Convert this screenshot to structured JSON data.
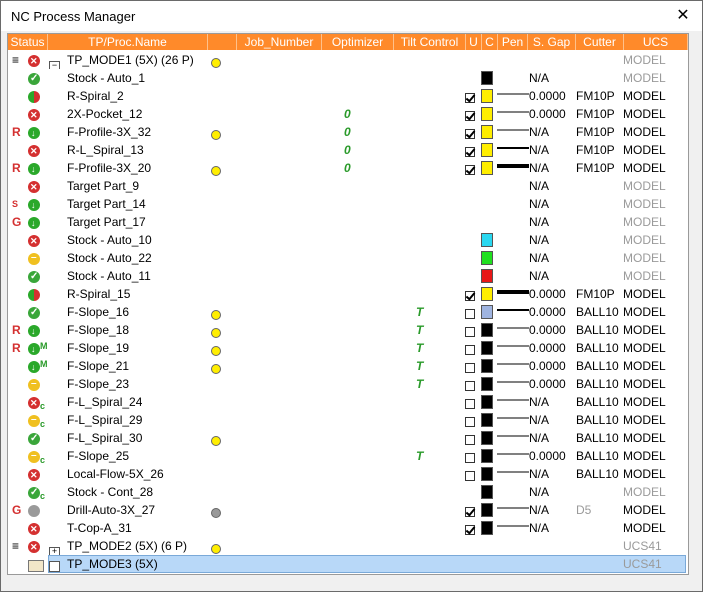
{
  "window": {
    "title": "NC Process Manager",
    "close_label": "✕"
  },
  "columns": [
    "Status",
    "TP/Proc.Name",
    "Job_Number",
    "Optimizer",
    "Tilt Control",
    "U",
    "C",
    "Pen",
    "S. Gap",
    "Cutter",
    "UCS"
  ],
  "rows": [
    {
      "prefix": "≡",
      "icon": "x",
      "suffix": "",
      "tree": "⊟",
      "name": "TP_MODE1 (5X) (26 P)",
      "bulb": "yellow",
      "opt": "",
      "tilt": "",
      "u": "",
      "color": "",
      "pen": 0,
      "gap": "",
      "cutter": "",
      "ucs": "MODEL",
      "ucs_gray": true
    },
    {
      "prefix": "",
      "icon": "check",
      "suffix": "",
      "tree": "",
      "name": "Stock - Auto_1",
      "bulb": "",
      "opt": "",
      "tilt": "",
      "u": "",
      "color": "#000000",
      "pen": 0,
      "gap": "N/A",
      "cutter": "",
      "ucs": "MODEL",
      "ucs_gray": true
    },
    {
      "prefix": "",
      "icon": "redgreen",
      "suffix": "",
      "tree": "",
      "name": "R-Spiral_2",
      "bulb": "",
      "opt": "",
      "tilt": "",
      "u": "on",
      "color": "#ffee00",
      "pen": 1,
      "gap": "0.0000",
      "cutter": "FM10P",
      "ucs": "MODEL",
      "ucs_gray": false
    },
    {
      "prefix": "",
      "icon": "x",
      "suffix": "",
      "tree": "",
      "name": "2X-Pocket_12",
      "bulb": "",
      "opt": "0",
      "tilt": "",
      "u": "on",
      "color": "#ffee00",
      "pen": 1,
      "gap": "0.0000",
      "cutter": "FM10P",
      "ucs": "MODEL",
      "ucs_gray": false
    },
    {
      "prefix": "R",
      "icon": "green",
      "suffix": "",
      "tree": "",
      "name": "F-Profile-3X_32",
      "bulb": "yellow",
      "opt": "0",
      "tilt": "",
      "u": "on",
      "color": "#ffee00",
      "pen": 1,
      "gap": "N/A",
      "cutter": "FM10P",
      "ucs": "MODEL",
      "ucs_gray": false
    },
    {
      "prefix": "",
      "icon": "x",
      "suffix": "",
      "tree": "",
      "name": "R-L_Spiral_13",
      "bulb": "",
      "opt": "0",
      "tilt": "",
      "u": "on",
      "color": "#ffee00",
      "pen": 2,
      "gap": "N/A",
      "cutter": "FM10P",
      "ucs": "MODEL",
      "ucs_gray": false
    },
    {
      "prefix": "R",
      "icon": "green",
      "suffix": "",
      "tree": "",
      "name": "F-Profile-3X_20",
      "bulb": "yellow",
      "opt": "0",
      "tilt": "",
      "u": "on",
      "color": "#ffee00",
      "pen": 4,
      "gap": "N/A",
      "cutter": "FM10P",
      "ucs": "MODEL",
      "ucs_gray": false
    },
    {
      "prefix": "",
      "icon": "x",
      "suffix": "",
      "tree": "",
      "name": "Target Part_9",
      "bulb": "",
      "opt": "",
      "tilt": "",
      "u": "",
      "color": "",
      "pen": 0,
      "gap": "N/A",
      "cutter": "",
      "ucs": "MODEL",
      "ucs_gray": true
    },
    {
      "prefix": "S",
      "icon": "green",
      "suffix": "",
      "tree": "",
      "name": "Target Part_14",
      "bulb": "",
      "opt": "",
      "tilt": "",
      "u": "",
      "color": "",
      "pen": 0,
      "gap": "N/A",
      "cutter": "",
      "ucs": "MODEL",
      "ucs_gray": true
    },
    {
      "prefix": "G",
      "icon": "green",
      "suffix": "",
      "tree": "",
      "name": "Target Part_17",
      "bulb": "",
      "opt": "",
      "tilt": "",
      "u": "",
      "color": "",
      "pen": 0,
      "gap": "N/A",
      "cutter": "",
      "ucs": "MODEL",
      "ucs_gray": true
    },
    {
      "prefix": "",
      "icon": "x",
      "suffix": "",
      "tree": "",
      "name": "Stock - Auto_10",
      "bulb": "",
      "opt": "",
      "tilt": "",
      "u": "",
      "color": "#2ad8f0",
      "pen": 0,
      "gap": "N/A",
      "cutter": "",
      "ucs": "MODEL",
      "ucs_gray": true
    },
    {
      "prefix": "",
      "icon": "yellow",
      "suffix": "",
      "tree": "",
      "name": "Stock - Auto_22",
      "bulb": "",
      "opt": "",
      "tilt": "",
      "u": "",
      "color": "#20e020",
      "pen": 0,
      "gap": "N/A",
      "cutter": "",
      "ucs": "MODEL",
      "ucs_gray": true
    },
    {
      "prefix": "",
      "icon": "check",
      "suffix": "",
      "tree": "",
      "name": "Stock - Auto_11",
      "bulb": "",
      "opt": "",
      "tilt": "",
      "u": "",
      "color": "#e81818",
      "pen": 0,
      "gap": "N/A",
      "cutter": "",
      "ucs": "MODEL",
      "ucs_gray": true
    },
    {
      "prefix": "",
      "icon": "redgreen",
      "suffix": "",
      "tree": "",
      "name": "R-Spiral_15",
      "bulb": "",
      "opt": "",
      "tilt": "",
      "u": "on",
      "color": "#ffee00",
      "pen": 4,
      "gap": "0.0000",
      "cutter": "FM10P",
      "ucs": "MODEL",
      "ucs_gray": false
    },
    {
      "prefix": "",
      "icon": "check",
      "suffix": "",
      "tree": "",
      "name": "F-Slope_16",
      "bulb": "yellow",
      "opt": "",
      "tilt": "T",
      "u": "off",
      "color": "#9fb4e0",
      "pen": 2,
      "gap": "0.0000",
      "cutter": "BALL10",
      "ucs": "MODEL",
      "ucs_gray": false
    },
    {
      "prefix": "R",
      "icon": "green",
      "suffix": "",
      "tree": "",
      "name": "F-Slope_18",
      "bulb": "yellow",
      "opt": "",
      "tilt": "T",
      "u": "off",
      "color": "#000000",
      "pen": 1,
      "gap": "0.0000",
      "cutter": "BALL10",
      "ucs": "MODEL",
      "ucs_gray": false
    },
    {
      "prefix": "R",
      "icon": "green",
      "suffix": "M",
      "tree": "",
      "name": "F-Slope_19",
      "bulb": "yellow",
      "opt": "",
      "tilt": "T",
      "u": "off",
      "color": "#000000",
      "pen": 1,
      "gap": "0.0000",
      "cutter": "BALL10",
      "ucs": "MODEL",
      "ucs_gray": false
    },
    {
      "prefix": "",
      "icon": "green",
      "suffix": "M",
      "tree": "",
      "name": "F-Slope_21",
      "bulb": "yellow",
      "opt": "",
      "tilt": "T",
      "u": "off",
      "color": "#000000",
      "pen": 1,
      "gap": "0.0000",
      "cutter": "BALL10",
      "ucs": "MODEL",
      "ucs_gray": false
    },
    {
      "prefix": "",
      "icon": "yellow",
      "suffix": "",
      "tree": "",
      "name": "F-Slope_23",
      "bulb": "",
      "opt": "",
      "tilt": "T",
      "u": "off",
      "color": "#000000",
      "pen": 1,
      "gap": "0.0000",
      "cutter": "BALL10",
      "ucs": "MODEL",
      "ucs_gray": false
    },
    {
      "prefix": "",
      "icon": "x",
      "suffix": "c",
      "tree": "",
      "name": "F-L_Spiral_24",
      "bulb": "",
      "opt": "",
      "tilt": "",
      "u": "off",
      "color": "#000000",
      "pen": 1,
      "gap": "N/A",
      "cutter": "BALL10",
      "ucs": "MODEL",
      "ucs_gray": false
    },
    {
      "prefix": "",
      "icon": "yellow",
      "suffix": "c",
      "tree": "",
      "name": "F-L_Spiral_29",
      "bulb": "",
      "opt": "",
      "tilt": "",
      "u": "off",
      "color": "#000000",
      "pen": 1,
      "gap": "N/A",
      "cutter": "BALL10",
      "ucs": "MODEL",
      "ucs_gray": false
    },
    {
      "prefix": "",
      "icon": "check",
      "suffix": "",
      "tree": "",
      "name": "F-L_Spiral_30",
      "bulb": "yellow",
      "opt": "",
      "tilt": "",
      "u": "off",
      "color": "#000000",
      "pen": 1,
      "gap": "N/A",
      "cutter": "BALL10",
      "ucs": "MODEL",
      "ucs_gray": false
    },
    {
      "prefix": "",
      "icon": "yellow",
      "suffix": "c",
      "tree": "",
      "name": "F-Slope_25",
      "bulb": "",
      "opt": "",
      "tilt": "T",
      "u": "off",
      "color": "#000000",
      "pen": 1,
      "gap": "0.0000",
      "cutter": "BALL10",
      "ucs": "MODEL",
      "ucs_gray": false
    },
    {
      "prefix": "",
      "icon": "x",
      "suffix": "",
      "tree": "",
      "name": "Local-Flow-5X_26",
      "bulb": "",
      "opt": "",
      "tilt": "",
      "u": "off",
      "color": "#000000",
      "pen": 1,
      "gap": "N/A",
      "cutter": "BALL10",
      "ucs": "MODEL",
      "ucs_gray": false
    },
    {
      "prefix": "",
      "icon": "check",
      "suffix": "c",
      "tree": "",
      "name": "Stock - Cont_28",
      "bulb": "",
      "opt": "",
      "tilt": "",
      "u": "",
      "color": "#000000",
      "pen": 0,
      "gap": "N/A",
      "cutter": "",
      "ucs": "MODEL",
      "ucs_gray": true
    },
    {
      "prefix": "G",
      "icon": "gray",
      "suffix": "",
      "tree": "",
      "name": "Drill-Auto-3X_27",
      "bulb": "gray",
      "opt": "",
      "tilt": "",
      "u": "on",
      "color": "#000000",
      "pen": 1,
      "gap": "N/A",
      "cutter": "D5",
      "cutter_gray": true,
      "ucs": "MODEL",
      "ucs_gray": false
    },
    {
      "prefix": "",
      "icon": "x",
      "suffix": "",
      "tree": "",
      "name": "T-Cop-A_31",
      "bulb": "",
      "opt": "",
      "tilt": "",
      "u": "on",
      "color": "#000000",
      "pen": 1,
      "gap": "N/A",
      "cutter": "",
      "ucs": "MODEL",
      "ucs_gray": false
    },
    {
      "prefix": "≡",
      "icon": "x",
      "suffix": "",
      "tree": "⊞",
      "name": "TP_MODE2 (5X) (6 P)",
      "bulb": "yellow",
      "opt": "",
      "tilt": "",
      "u": "",
      "color": "",
      "pen": 0,
      "gap": "",
      "cutter": "",
      "ucs": "UCS41",
      "ucs_gray": true
    },
    {
      "prefix": "",
      "icon": "folder",
      "suffix": "",
      "tree": "□",
      "name": "TP_MODE3 (5X)",
      "bulb": "",
      "opt": "",
      "tilt": "",
      "u": "",
      "color": "",
      "pen": 0,
      "gap": "",
      "cutter": "",
      "ucs": "UCS41",
      "ucs_gray": true,
      "selected": true
    }
  ]
}
